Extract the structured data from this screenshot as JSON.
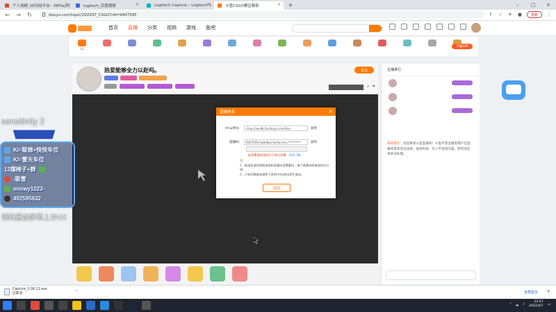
{
  "browser": {
    "tabs": [
      {
        "label": "个人战绩_5E对战平台 - 5EPlay对",
        "active": false,
        "color": "#e24a3b"
      },
      {
        "label": "logitech_百度搜索",
        "active": false,
        "color": "#3a6be0"
      },
      {
        "label": "Logitech Capture – Logitech S",
        "active": false,
        "color": "#00b3c8"
      },
      {
        "label": "斗鱼CSGO赛区精彩",
        "active": true,
        "color": "#ff7a00"
      }
    ],
    "url": "douyu.com/topic/2022ST_CSGO?rid=9407595",
    "update_label": "更新"
  },
  "site": {
    "nav": [
      {
        "label": "首页",
        "on": false
      },
      {
        "label": "直播",
        "on": true
      },
      {
        "label": "分类",
        "on": false
      },
      {
        "label": "视频",
        "on": false
      },
      {
        "label": "游戏",
        "on": false
      },
      {
        "label": "鱼吧",
        "on": false
      }
    ],
    "download_app_label": "下载APP",
    "categories": [
      "11",
      "",
      "",
      "",
      "",
      "",
      "",
      "",
      "",
      "",
      "",
      "",
      "",
      "",
      "",
      ""
    ]
  },
  "room": {
    "title": "热爱能够全力以赴吗。",
    "tag_follow": "关注"
  },
  "panel": {
    "tabs": [
      "主播排行",
      ""
    ],
    "chat_system": "系统提示：",
    "chat_body": "欢迎来到斗鱼直播间！斗鱼严禁主播及用户在直播间发布违法违规、低俗色情、引人不适等内容，若有违反将依法处理。"
  },
  "overlay": {
    "sensitivity": "sensitivity 2",
    "lines": [
      {
        "text": "KI=联想+快快车位",
        "color": "#5aa9f0"
      },
      {
        "text": "KI=雷天车位",
        "color": "#5aa9f0"
      },
      {
        "text": "12摆椅子+群",
        "color": "#59b34a"
      },
      {
        "text": "-联雪",
        "color": "#e04b3a"
      },
      {
        "text": "snowy1023-",
        "color": "#59b34a"
      },
      {
        "text": "492595632",
        "color": "#333333"
      }
    ],
    "vx_note": "调机器加屏幕上方VX"
  },
  "modal": {
    "title": "直播信息",
    "rtmp_label": "rtmp地址：",
    "rtmp_value": "rtmp://sendtc3a.douyu.com/live",
    "copy_label": "复制",
    "key_label": "直播码：",
    "key_value": "9407595rYqbhBos?wsSecret=*********",
    "warn": "若您需要修改码后已停止直播",
    "warn_link": "如何了解",
    "notes": [
      "注：",
      "1、推流前请获取推流码和直播间设置重码，每个直播间的推流码为分钟。",
      "2、只有切换推流或换下录的rtmp地址发生变化。"
    ],
    "confirm": "关闭"
  },
  "downloads": {
    "file": "Capture_2.06.11.exe",
    "status": "已取消",
    "show_all": "全部显示"
  },
  "taskbar": {
    "time": "22:27",
    "date": "2022/4/7"
  }
}
